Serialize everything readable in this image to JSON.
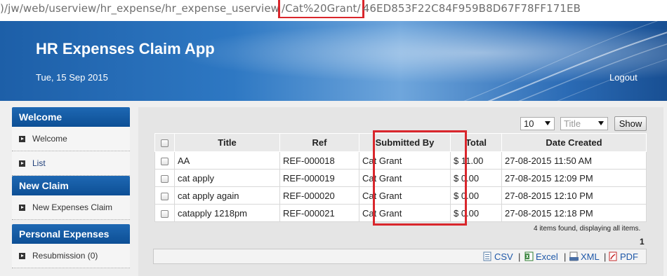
{
  "url": {
    "prefix": ")/jw/web/userview/hr_expense/hr_expense_userview",
    "highlight": "/Cat%20Grant/",
    "suffix": "46ED853F22C84F959B8D67F78FF171EB"
  },
  "header": {
    "title": "HR Expenses Claim App",
    "date": "Tue, 15 Sep 2015",
    "logout": "Logout"
  },
  "sidebar": {
    "sections": [
      {
        "title": "Welcome",
        "items": [
          {
            "label": "Welcome"
          },
          {
            "label": "List"
          }
        ]
      },
      {
        "title": "New Claim",
        "items": [
          {
            "label": "New Expenses Claim"
          }
        ]
      },
      {
        "title": "Personal Expenses",
        "items": [
          {
            "label": "Resubmission (0)"
          }
        ]
      }
    ]
  },
  "controls": {
    "page_size": "10",
    "sort_field": "Title",
    "show_label": "Show"
  },
  "table": {
    "headers": [
      "Title",
      "Ref",
      "Submitted By",
      "Total",
      "Date Created"
    ],
    "rows": [
      [
        "AA",
        "REF-000018",
        "Cat Grant",
        "$ 11.00",
        "27-08-2015 11:50 AM"
      ],
      [
        "cat apply",
        "REF-000019",
        "Cat Grant",
        "$ 0.00",
        "27-08-2015 12:09 PM"
      ],
      [
        "cat apply again",
        "REF-000020",
        "Cat Grant",
        "$ 0.00",
        "27-08-2015 12:10 PM"
      ],
      [
        "catapply 1218pm",
        "REF-000021",
        "Cat Grant",
        "$ 0.00",
        "27-08-2015 12:18 PM"
      ]
    ]
  },
  "footer": {
    "found_text": "4 items found, displaying all items.",
    "page": "1"
  },
  "export": {
    "csv": "CSV",
    "excel": "Excel",
    "xml": "XML",
    "pdf": "PDF",
    "separator": "|"
  },
  "colors": {
    "highlight": "#d9262c",
    "header_blue": "#1d5fa8",
    "link": "#1f58a8"
  }
}
